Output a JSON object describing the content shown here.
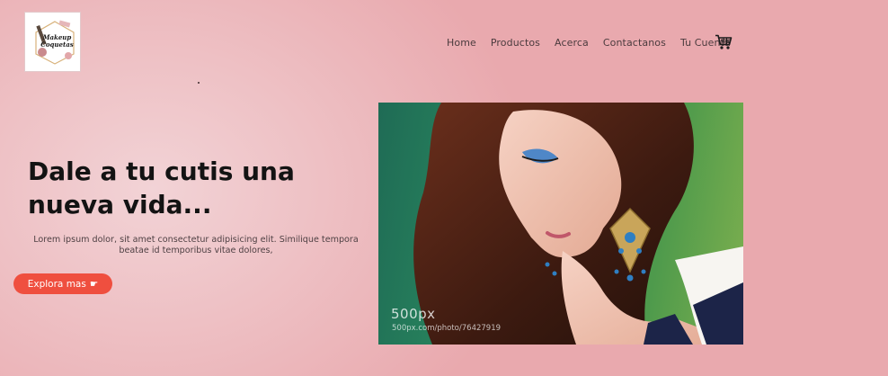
{
  "brand": {
    "logo_line1": "Makeup",
    "logo_line2": "Coquetas"
  },
  "nav": {
    "items": [
      "Home",
      "Productos",
      "Acerca",
      "Contactanos",
      "Tu Cuenta"
    ],
    "cart_icon": "cart-icon"
  },
  "hero": {
    "title": "Dale a tu cutis una nueva vida...",
    "description": "Lorem ipsum dolor, sit amet consectetur adipisicing elit. Similique tempora beatae id temporibus vitae dolores,",
    "cta_label": "Explora mas",
    "cta_icon": "☛"
  },
  "photo": {
    "watermark": "500px",
    "watermark_url": "500px.com/photo/76427919"
  },
  "colors": {
    "accent": "#ef4f3f",
    "background": "#eaadb1"
  }
}
